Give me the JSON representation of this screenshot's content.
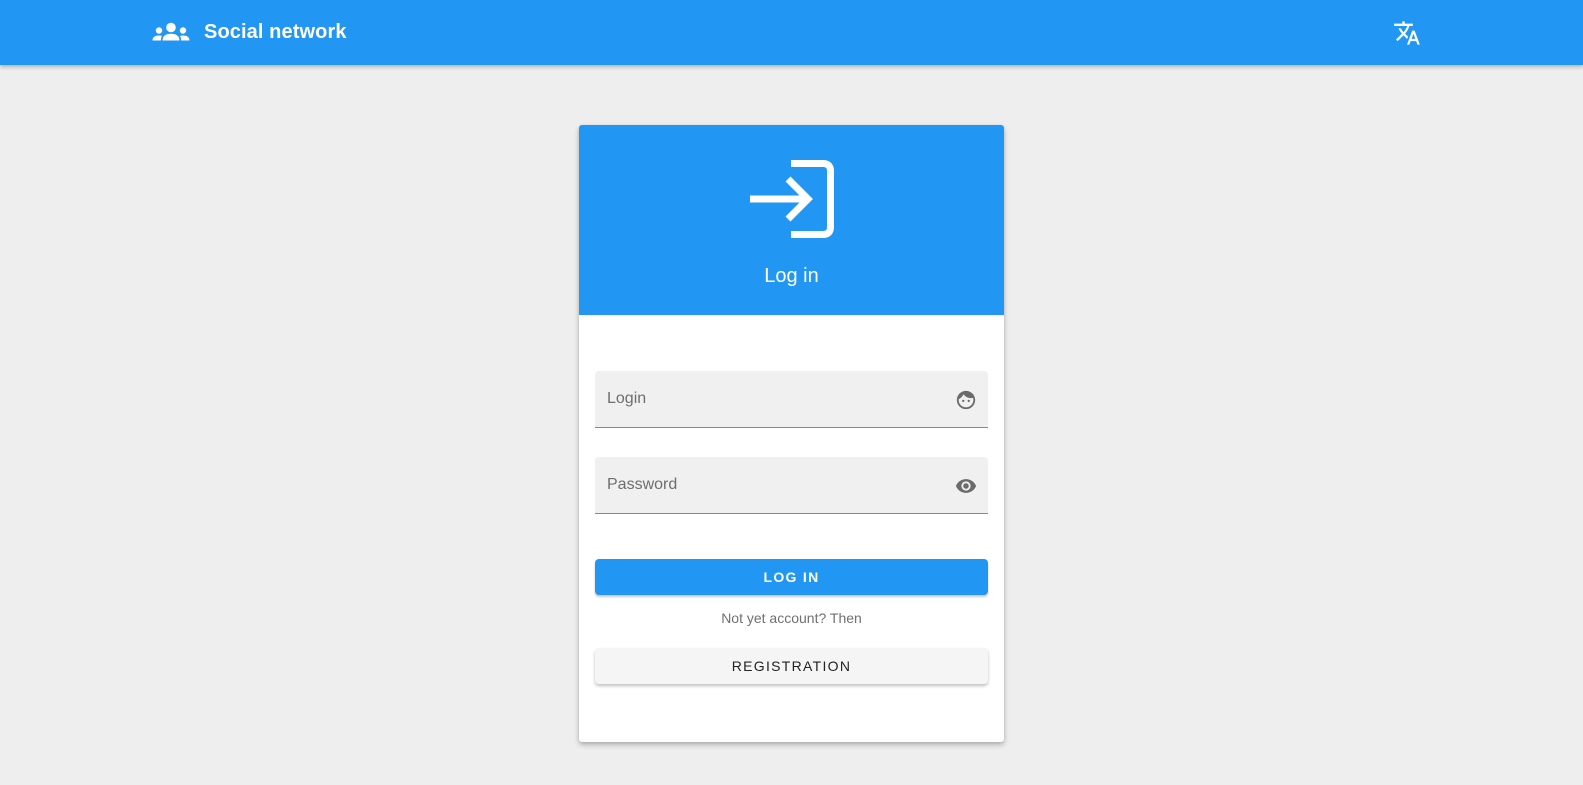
{
  "appbar": {
    "title": "Social network",
    "brand_icon": "group-icon",
    "translate_icon": "translate-icon",
    "color": "#2196f3"
  },
  "login_card": {
    "header_icon": "login-icon",
    "title": "Log in",
    "login_field": {
      "placeholder": "Login",
      "value": "",
      "icon": "face-icon"
    },
    "password_field": {
      "placeholder": "Password",
      "value": "",
      "icon": "eye-icon"
    },
    "login_button_label": "LOG IN",
    "registration_hint": "Not yet account? Then",
    "registration_button_label": "REGISTRATION"
  }
}
